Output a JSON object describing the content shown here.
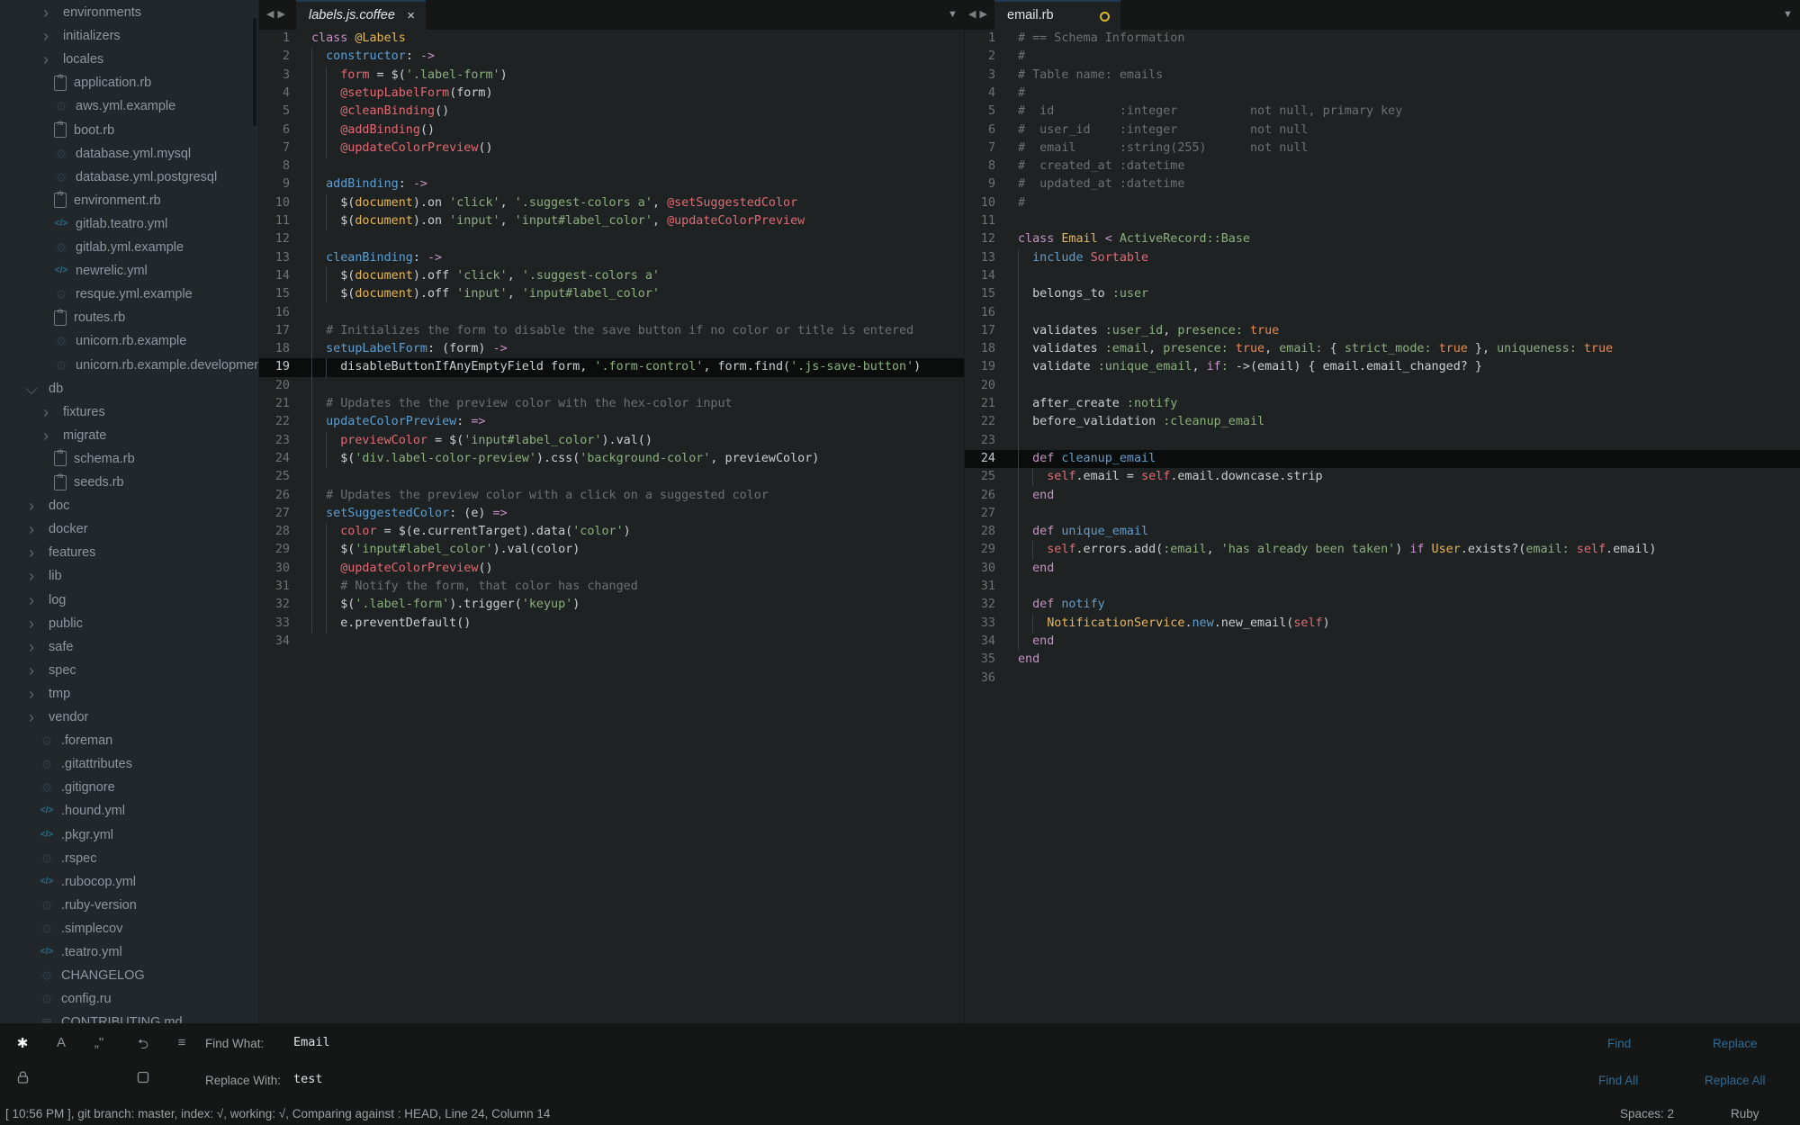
{
  "sidebar": {
    "items": [
      {
        "label": "environments",
        "type": "folder",
        "expanded": false,
        "depth": 2
      },
      {
        "label": "initializers",
        "type": "folder",
        "expanded": false,
        "depth": 2
      },
      {
        "label": "locales",
        "type": "folder",
        "expanded": false,
        "depth": 2
      },
      {
        "label": "application.rb",
        "type": "file",
        "icon": "ruby-file-icon",
        "depth": 2
      },
      {
        "label": "aws.yml.example",
        "type": "file",
        "icon": "gear-icon",
        "depth": 2
      },
      {
        "label": "boot.rb",
        "type": "file",
        "icon": "ruby-file-icon",
        "depth": 2
      },
      {
        "label": "database.yml.mysql",
        "type": "file",
        "icon": "gear-icon",
        "depth": 2
      },
      {
        "label": "database.yml.postgresql",
        "type": "file",
        "icon": "gear-icon",
        "depth": 2
      },
      {
        "label": "environment.rb",
        "type": "file",
        "icon": "ruby-file-icon",
        "depth": 2
      },
      {
        "label": "gitlab.teatro.yml",
        "type": "file",
        "icon": "code-icon",
        "depth": 2
      },
      {
        "label": "gitlab.yml.example",
        "type": "file",
        "icon": "gear-icon",
        "depth": 2
      },
      {
        "label": "newrelic.yml",
        "type": "file",
        "icon": "code-icon",
        "depth": 2
      },
      {
        "label": "resque.yml.example",
        "type": "file",
        "icon": "gear-icon",
        "depth": 2
      },
      {
        "label": "routes.rb",
        "type": "file",
        "icon": "ruby-file-icon",
        "depth": 2
      },
      {
        "label": "unicorn.rb.example",
        "type": "file",
        "icon": "gear-icon",
        "depth": 2
      },
      {
        "label": "unicorn.rb.example.development",
        "type": "file",
        "icon": "gear-icon",
        "depth": 2
      },
      {
        "label": "db",
        "type": "folder",
        "expanded": true,
        "depth": 1
      },
      {
        "label": "fixtures",
        "type": "folder",
        "expanded": false,
        "depth": 2
      },
      {
        "label": "migrate",
        "type": "folder",
        "expanded": false,
        "depth": 2
      },
      {
        "label": "schema.rb",
        "type": "file",
        "icon": "ruby-file-icon",
        "depth": 2
      },
      {
        "label": "seeds.rb",
        "type": "file",
        "icon": "ruby-file-icon",
        "depth": 2
      },
      {
        "label": "doc",
        "type": "folder",
        "expanded": false,
        "depth": 1
      },
      {
        "label": "docker",
        "type": "folder",
        "expanded": false,
        "depth": 1
      },
      {
        "label": "features",
        "type": "folder",
        "expanded": false,
        "depth": 1
      },
      {
        "label": "lib",
        "type": "folder",
        "expanded": false,
        "depth": 1
      },
      {
        "label": "log",
        "type": "folder",
        "expanded": false,
        "depth": 1
      },
      {
        "label": "public",
        "type": "folder",
        "expanded": false,
        "depth": 1
      },
      {
        "label": "safe",
        "type": "folder",
        "expanded": false,
        "depth": 1
      },
      {
        "label": "spec",
        "type": "folder",
        "expanded": false,
        "depth": 1
      },
      {
        "label": "tmp",
        "type": "folder",
        "expanded": false,
        "depth": 1
      },
      {
        "label": "vendor",
        "type": "folder",
        "expanded": false,
        "depth": 1
      },
      {
        "label": ".foreman",
        "type": "file",
        "icon": "gear-icon",
        "depth": 1
      },
      {
        "label": ".gitattributes",
        "type": "file",
        "icon": "gear-icon",
        "depth": 1
      },
      {
        "label": ".gitignore",
        "type": "file",
        "icon": "gear-icon",
        "depth": 1
      },
      {
        "label": ".hound.yml",
        "type": "file",
        "icon": "code-icon",
        "depth": 1
      },
      {
        "label": ".pkgr.yml",
        "type": "file",
        "icon": "code-icon",
        "depth": 1
      },
      {
        "label": ".rspec",
        "type": "file",
        "icon": "gear-icon",
        "depth": 1
      },
      {
        "label": ".rubocop.yml",
        "type": "file",
        "icon": "code-icon",
        "depth": 1
      },
      {
        "label": ".ruby-version",
        "type": "file",
        "icon": "gear-icon",
        "depth": 1
      },
      {
        "label": ".simplecov",
        "type": "file",
        "icon": "gear-icon",
        "depth": 1
      },
      {
        "label": ".teatro.yml",
        "type": "file",
        "icon": "code-icon",
        "depth": 1
      },
      {
        "label": "CHANGELOG",
        "type": "file",
        "icon": "gear-icon",
        "depth": 1
      },
      {
        "label": "config.ru",
        "type": "file",
        "icon": "gear-icon",
        "depth": 1
      },
      {
        "label": "CONTRIBUTING.md",
        "type": "file",
        "icon": "doc-icon",
        "depth": 1
      }
    ]
  },
  "left_pane": {
    "tab": {
      "label": "labels.js.coffee",
      "close": "×",
      "italic": true
    },
    "current_line": 19,
    "lines": [
      [
        [
          "k",
          "class "
        ],
        [
          "y",
          "@Labels"
        ]
      ],
      [
        [
          "",
          "  "
        ],
        [
          "f",
          "constructor"
        ],
        [
          "",
          "<colon>"
        ],
        [
          "p",
          " ->"
        ]
      ],
      [
        [
          "",
          "    "
        ],
        [
          "i",
          "form"
        ],
        [
          "",
          " = $("
        ],
        [
          "s",
          "'.label-form'"
        ],
        [
          "",
          ")"
        ]
      ],
      [
        [
          "",
          "    "
        ],
        [
          "i",
          "@setupLabelForm"
        ],
        [
          "",
          "(form)"
        ]
      ],
      [
        [
          "",
          "    "
        ],
        [
          "i",
          "@cleanBinding"
        ],
        [
          "",
          "()"
        ]
      ],
      [
        [
          "",
          "    "
        ],
        [
          "i",
          "@addBinding"
        ],
        [
          "",
          "()"
        ]
      ],
      [
        [
          "",
          "    "
        ],
        [
          "i",
          "@updateColorPreview"
        ],
        [
          "",
          "()"
        ]
      ],
      [],
      [
        [
          "",
          "  "
        ],
        [
          "f",
          "addBinding"
        ],
        [
          "",
          "<colon>"
        ],
        [
          "p",
          " ->"
        ]
      ],
      [
        [
          "",
          "    $("
        ],
        [
          "y",
          "document"
        ],
        [
          "",
          ").on "
        ],
        [
          "s",
          "'click'"
        ],
        [
          "",
          ", "
        ],
        [
          "s",
          "'.suggest-colors a'"
        ],
        [
          "",
          ", "
        ],
        [
          "i",
          "@setSuggestedColor"
        ]
      ],
      [
        [
          "",
          "    $("
        ],
        [
          "y",
          "document"
        ],
        [
          "",
          ").on "
        ],
        [
          "s",
          "'input'"
        ],
        [
          "",
          ", "
        ],
        [
          "s",
          "'input#label_color'"
        ],
        [
          "",
          ", "
        ],
        [
          "i",
          "@updateColorPreview"
        ]
      ],
      [],
      [
        [
          "",
          "  "
        ],
        [
          "f",
          "cleanBinding"
        ],
        [
          "",
          "<colon>"
        ],
        [
          "p",
          " ->"
        ]
      ],
      [
        [
          "",
          "    $("
        ],
        [
          "y",
          "document"
        ],
        [
          "",
          ").off "
        ],
        [
          "s",
          "'click'"
        ],
        [
          "",
          ", "
        ],
        [
          "s",
          "'.suggest-colors a'"
        ]
      ],
      [
        [
          "",
          "    $("
        ],
        [
          "y",
          "document"
        ],
        [
          "",
          ").off "
        ],
        [
          "s",
          "'input'"
        ],
        [
          "",
          ", "
        ],
        [
          "s",
          "'input#label_color'"
        ]
      ],
      [],
      [
        [
          "c",
          "  # Initializes the form to disable the save button if no color or title is entered"
        ]
      ],
      [
        [
          "",
          "  "
        ],
        [
          "f",
          "setupLabelForm"
        ],
        [
          "",
          "<colon> (form)"
        ],
        [
          "p",
          " ->"
        ]
      ],
      [
        [
          "",
          "    disableButtonIfAnyEmptyField form, "
        ],
        [
          "s",
          "'.form-control'"
        ],
        [
          "",
          ", form.find("
        ],
        [
          "s",
          "'.js-save-button'"
        ],
        [
          "",
          ")"
        ]
      ],
      [],
      [
        [
          "c",
          "  # Updates the the preview color with the hex-color input"
        ]
      ],
      [
        [
          "",
          "  "
        ],
        [
          "f",
          "updateColorPreview"
        ],
        [
          "",
          "<colon>"
        ],
        [
          "p",
          " =>"
        ]
      ],
      [
        [
          "",
          "    "
        ],
        [
          "i",
          "previewColor"
        ],
        [
          "",
          " = $("
        ],
        [
          "s",
          "'input#label_color'"
        ],
        [
          "",
          ").val()"
        ]
      ],
      [
        [
          "",
          "    $("
        ],
        [
          "s",
          "'div.label-color-preview'"
        ],
        [
          "",
          ").css("
        ],
        [
          "s",
          "'background-color'"
        ],
        [
          "",
          ", previewColor)"
        ]
      ],
      [],
      [
        [
          "c",
          "  # Updates the preview color with a click on a suggested color"
        ]
      ],
      [
        [
          "",
          "  "
        ],
        [
          "f",
          "setSuggestedColor"
        ],
        [
          "",
          "<colon> (e)"
        ],
        [
          "p",
          " =>"
        ]
      ],
      [
        [
          "",
          "    "
        ],
        [
          "i",
          "color"
        ],
        [
          "",
          " = $(e.currentTarget).data("
        ],
        [
          "s",
          "'color'"
        ],
        [
          "",
          ")"
        ]
      ],
      [
        [
          "",
          "    $("
        ],
        [
          "s",
          "'input#label_color'"
        ],
        [
          "",
          ").val(color)"
        ]
      ],
      [
        [
          "",
          "    "
        ],
        [
          "i",
          "@updateColorPreview"
        ],
        [
          "",
          "()"
        ]
      ],
      [
        [
          "c",
          "    # Notify the form, that color has changed"
        ]
      ],
      [
        [
          "",
          "    $("
        ],
        [
          "s",
          "'.label-form'"
        ],
        [
          "",
          ").trigger("
        ],
        [
          "s",
          "'keyup'"
        ],
        [
          "",
          ")"
        ]
      ],
      [
        [
          "",
          "    e.preventDefault()"
        ]
      ],
      []
    ]
  },
  "right_pane": {
    "tab": {
      "label": "email.rb",
      "dirty": true
    },
    "current_line": 24,
    "lines": [
      [
        [
          "c",
          "# == Schema Information"
        ]
      ],
      [
        [
          "c",
          "#"
        ]
      ],
      [
        [
          "c",
          "# Table name: emails"
        ]
      ],
      [
        [
          "c",
          "#"
        ]
      ],
      [
        [
          "c",
          "#  id         :integer          not null, primary key"
        ]
      ],
      [
        [
          "c",
          "#  user_id    :integer          not null"
        ]
      ],
      [
        [
          "c",
          "#  email      :string(255)      not null"
        ]
      ],
      [
        [
          "c",
          "#  created_at :datetime"
        ]
      ],
      [
        [
          "c",
          "#  updated_at :datetime"
        ]
      ],
      [
        [
          "c",
          "#"
        ]
      ],
      [],
      [
        [
          "k",
          "class "
        ],
        [
          "y",
          "Email"
        ],
        [
          "k",
          " < "
        ],
        [
          "s",
          "ActiveRecord::Base"
        ]
      ],
      [
        [
          "",
          "  "
        ],
        [
          "f",
          "include "
        ],
        [
          "i",
          "Sortable"
        ]
      ],
      [],
      [
        [
          "",
          "  belongs_to "
        ],
        [
          "s",
          ":user"
        ]
      ],
      [],
      [
        [
          "",
          "  validates "
        ],
        [
          "s",
          ":user_id"
        ],
        [
          "",
          ", "
        ],
        [
          "s",
          "presence:"
        ],
        [
          "o",
          " true"
        ]
      ],
      [
        [
          "",
          "  validates "
        ],
        [
          "s",
          ":email"
        ],
        [
          "",
          ", "
        ],
        [
          "s",
          "presence:"
        ],
        [
          "o",
          " true"
        ],
        [
          "",
          ", "
        ],
        [
          "s",
          "email:"
        ],
        [
          "",
          " { "
        ],
        [
          "s",
          "strict_mode:"
        ],
        [
          "o",
          " true"
        ],
        [
          "",
          " }, "
        ],
        [
          "s",
          "uniqueness:"
        ],
        [
          "o",
          " true"
        ]
      ],
      [
        [
          "",
          "  validate "
        ],
        [
          "s",
          ":unique_email"
        ],
        [
          "",
          ", "
        ],
        [
          "k",
          "if"
        ],
        [
          "s",
          ":"
        ],
        [
          "",
          " ->(email) { email.email_changed? }"
        ]
      ],
      [],
      [
        [
          "",
          "  after_create "
        ],
        [
          "s",
          ":notify"
        ]
      ],
      [
        [
          "",
          "  before_validation "
        ],
        [
          "s",
          ":cleanup_email"
        ]
      ],
      [],
      [
        [
          "",
          "  "
        ],
        [
          "k",
          "def "
        ],
        [
          "f",
          "cleanup_email"
        ]
      ],
      [
        [
          "",
          "    "
        ],
        [
          "i",
          "self"
        ],
        [
          "",
          ".email = "
        ],
        [
          "i",
          "self"
        ],
        [
          "",
          ".email.downcase.strip"
        ]
      ],
      [
        [
          "",
          "  "
        ],
        [
          "k",
          "end"
        ]
      ],
      [],
      [
        [
          "",
          "  "
        ],
        [
          "k",
          "def "
        ],
        [
          "f",
          "unique_email"
        ]
      ],
      [
        [
          "",
          "    "
        ],
        [
          "i",
          "self"
        ],
        [
          "",
          ".errors.add("
        ],
        [
          "s",
          ":email"
        ],
        [
          "",
          ", "
        ],
        [
          "s",
          "'has already been taken'"
        ],
        [
          "",
          ") "
        ],
        [
          "k",
          "if "
        ],
        [
          "y",
          "User"
        ],
        [
          "",
          ".exists?("
        ],
        [
          "s",
          "email:"
        ],
        [
          "i",
          " self"
        ],
        [
          "",
          ".email)"
        ]
      ],
      [
        [
          "",
          "  "
        ],
        [
          "k",
          "end"
        ]
      ],
      [],
      [
        [
          "",
          "  "
        ],
        [
          "k",
          "def "
        ],
        [
          "f",
          "notify"
        ]
      ],
      [
        [
          "",
          "    "
        ],
        [
          "y",
          "NotificationService"
        ],
        [
          "",
          "."
        ],
        [
          "f",
          "new"
        ],
        [
          "",
          ".new_email("
        ],
        [
          "i",
          "self"
        ],
        [
          "",
          ")"
        ]
      ],
      [
        [
          "",
          "  "
        ],
        [
          "k",
          "end"
        ]
      ],
      [
        [
          "k",
          "end"
        ]
      ],
      []
    ]
  },
  "find_panel": {
    "toggles": [
      {
        "name": "regex-toggle-icon",
        "glyph": "✱",
        "active": true
      },
      {
        "name": "case-sensitive-toggle-icon",
        "glyph": "A",
        "active": false
      },
      {
        "name": "whole-word-toggle-icon",
        "glyph": "„\"",
        "active": false
      },
      {
        "name": "wrap-toggle-icon",
        "glyph": "⮌",
        "active": false
      },
      {
        "name": "in-selection-toggle-icon",
        "glyph": "≡",
        "active": false
      }
    ],
    "row2_toggles": [
      {
        "name": "lock-icon",
        "glyph": "🔒"
      },
      {
        "name": "preserve-case-checkbox-icon",
        "glyph": "☐"
      }
    ],
    "find_label": "Find What:",
    "find_value": "Email",
    "replace_label": "Replace With:",
    "replace_value": "test",
    "buttons": {
      "find": "Find",
      "replace": "Replace",
      "find_all": "Find All",
      "replace_all": "Replace All"
    }
  },
  "status_bar": {
    "left": "[ 10:56 PM ], git branch: master, index: √, working: √, Comparing against : HEAD, Line 24, Column 14",
    "spaces": "Spaces: 2",
    "syntax": "Ruby"
  },
  "colors": {
    "tab_accent": "#213a52",
    "dirty_indicator": "#d8b531",
    "find_button": "#2f6a97"
  }
}
